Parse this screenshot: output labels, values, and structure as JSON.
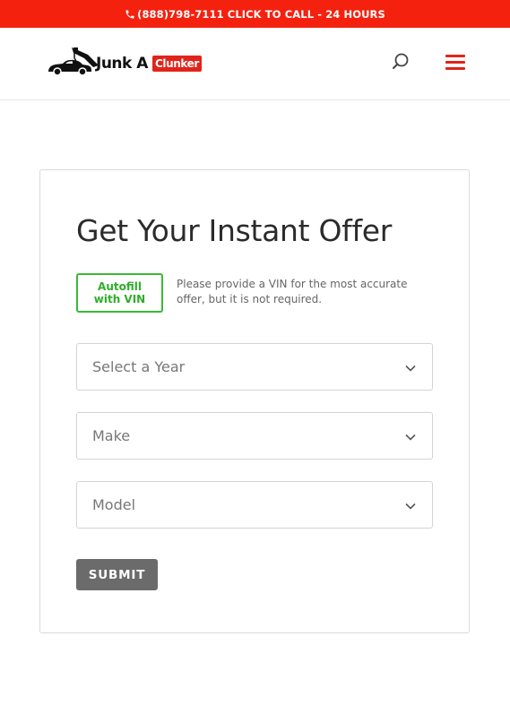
{
  "topbar": {
    "phone_text": "(888)798-7111 CLICK TO CALL - 24 HOURS",
    "icon": "phone-icon",
    "background": "#f5210f"
  },
  "header": {
    "logo": {
      "text": "Junk A",
      "badge": "Clunker",
      "badge_color": "#e2231a"
    },
    "search_icon": "search-icon",
    "menu_icon": "hamburger-menu-icon",
    "menu_color": "#e2231a"
  },
  "form": {
    "title": "Get Your Instant Offer",
    "autofill_label": "Autofill with VIN",
    "autofill_color": "#3bb935",
    "vin_note": "Please provide a VIN for the most accurate offer, but it is not required.",
    "year_select": {
      "label": "Select a Year",
      "icon": "chevron-down-icon"
    },
    "make_select": {
      "label": "Make",
      "icon": "chevron-down-icon"
    },
    "model_select": {
      "label": "Model",
      "icon": "chevron-down-icon"
    },
    "submit_label": "SUBMIT",
    "submit_color": "#6b6b6b"
  }
}
